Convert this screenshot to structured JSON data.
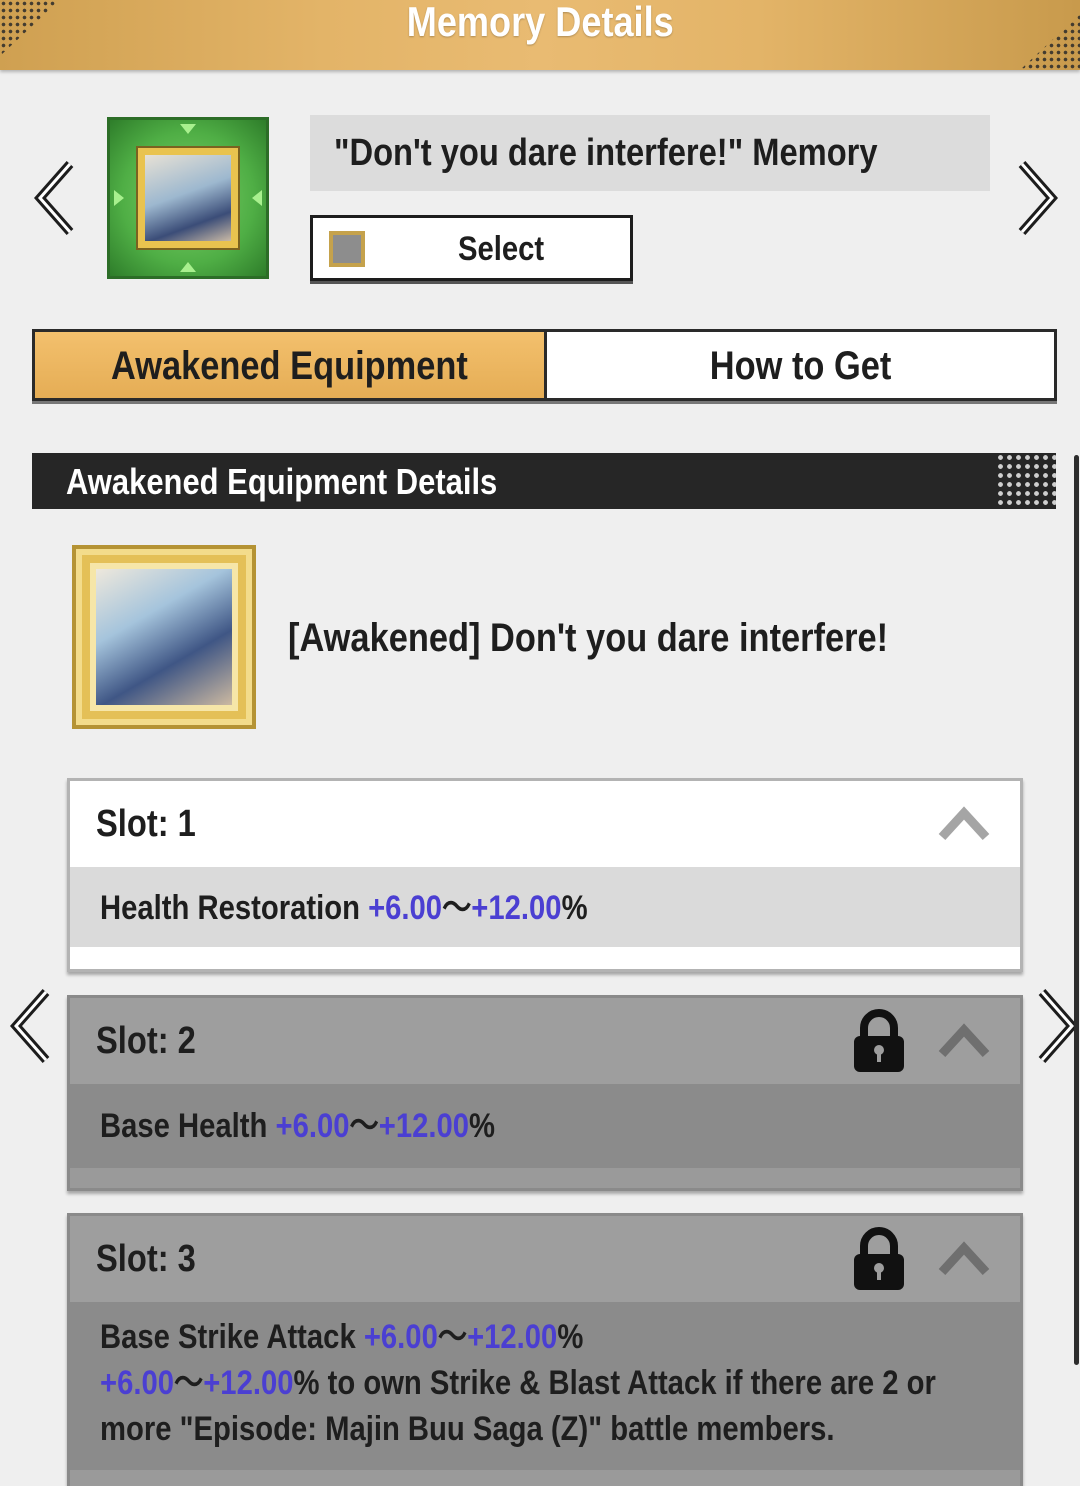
{
  "header": {
    "title": "Memory Details"
  },
  "memory": {
    "name": "\"Don't you dare interfere!\" Memory",
    "select_label": "Select"
  },
  "tabs": [
    {
      "label": "Awakened Equipment",
      "active": true
    },
    {
      "label": "How to Get",
      "active": false
    }
  ],
  "section": {
    "title": "Awakened Equipment Details"
  },
  "awakened": {
    "name": "[Awakened] Don't you dare interfere!"
  },
  "slots": [
    {
      "title": "Slot: 1",
      "locked": false,
      "lines": [
        {
          "stat": "Health Restoration",
          "min": "+6.00",
          "sep": "〜",
          "max": "+12.00",
          "suffix": "%"
        }
      ]
    },
    {
      "title": "Slot: 2",
      "locked": true,
      "lines": [
        {
          "stat": "Base Health",
          "min": "+6.00",
          "sep": "〜",
          "max": "+12.00",
          "suffix": "%"
        }
      ]
    },
    {
      "title": "Slot: 3",
      "locked": true,
      "lines": [
        {
          "stat": "Base Strike Attack",
          "min": "+6.00",
          "sep": "〜",
          "max": "+12.00",
          "suffix": "%"
        },
        {
          "min": "+6.00",
          "sep": "〜",
          "max": "+12.00",
          "suffix": "% to own Strike & Blast Attack if there are 2 or"
        },
        {
          "text": "more \"Episode: Majin Buu Saga (Z)\" battle members."
        }
      ]
    }
  ],
  "colors": {
    "accent": "#e5ad55",
    "value_blue": "#4b3fd2",
    "dark": "#262626"
  },
  "icons": [
    "chevron-left-icon",
    "chevron-right-icon",
    "caret-up-icon",
    "lock-icon"
  ]
}
